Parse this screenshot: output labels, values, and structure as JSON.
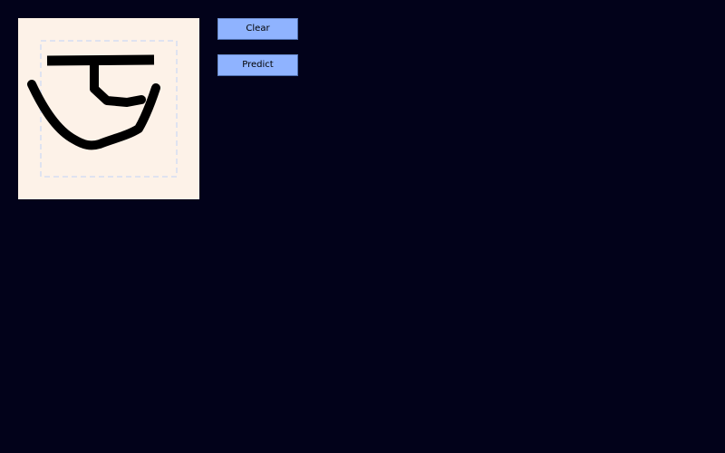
{
  "canvas": {
    "background": "#fdf2e8",
    "guide_color": "#dfe3f0",
    "stroke_color": "#000000"
  },
  "controls": {
    "clear_label": "Clear",
    "predict_label": "Predict"
  },
  "theme": {
    "window_background": "#02021a",
    "button_background": "#8fb3ff"
  }
}
